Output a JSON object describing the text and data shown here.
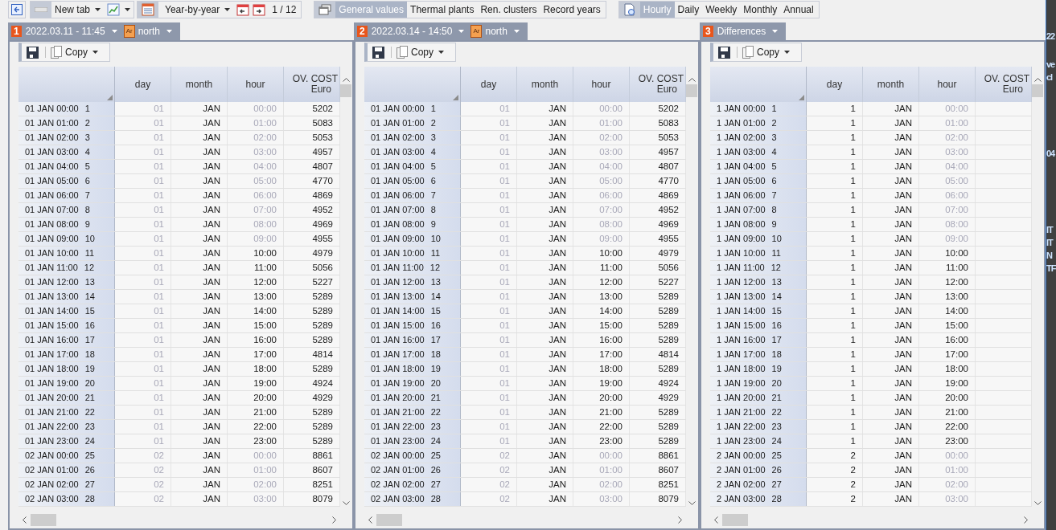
{
  "toolbar": {
    "new_tab": "New tab",
    "mode": "Year-by-year",
    "page": "1 / 12",
    "categories": [
      {
        "label": "General values",
        "selected": true
      },
      {
        "label": "Thermal plants",
        "selected": false
      },
      {
        "label": "Ren. clusters",
        "selected": false
      },
      {
        "label": "Record years",
        "selected": false
      }
    ],
    "periods": [
      {
        "label": "Hourly",
        "selected": true
      },
      {
        "label": "Daily",
        "selected": false
      },
      {
        "label": "Weekly",
        "selected": false
      },
      {
        "label": "Monthly",
        "selected": false
      },
      {
        "label": "Annual",
        "selected": false
      }
    ]
  },
  "panels": [
    {
      "number": "1",
      "title": "2022.03.11 - 11:45",
      "area": {
        "badge": "Ar",
        "name": "north"
      },
      "copy": "Copy",
      "columns": [
        {
          "label": "day"
        },
        {
          "label": "month"
        },
        {
          "label": "hour"
        },
        {
          "label": "OV. COST",
          "unit": "Euro"
        }
      ],
      "rows": [
        {
          "label": "01 JAN 00:00",
          "index": "1",
          "cells": [
            {
              "text": "01",
              "dim": true
            },
            {
              "text": "JAN",
              "dim": false
            },
            {
              "text": "00:00",
              "dim": true
            },
            {
              "text": "5202",
              "dim": false
            }
          ]
        },
        {
          "label": "01 JAN 01:00",
          "index": "2",
          "cells": [
            {
              "text": "01",
              "dim": true
            },
            {
              "text": "JAN",
              "dim": false
            },
            {
              "text": "01:00",
              "dim": true
            },
            {
              "text": "5083",
              "dim": false
            }
          ]
        },
        {
          "label": "01 JAN 02:00",
          "index": "3",
          "cells": [
            {
              "text": "01",
              "dim": true
            },
            {
              "text": "JAN",
              "dim": false
            },
            {
              "text": "02:00",
              "dim": true
            },
            {
              "text": "5053",
              "dim": false
            }
          ]
        },
        {
          "label": "01 JAN 03:00",
          "index": "4",
          "cells": [
            {
              "text": "01",
              "dim": true
            },
            {
              "text": "JAN",
              "dim": false
            },
            {
              "text": "03:00",
              "dim": true
            },
            {
              "text": "4957",
              "dim": false
            }
          ]
        },
        {
          "label": "01 JAN 04:00",
          "index": "5",
          "cells": [
            {
              "text": "01",
              "dim": true
            },
            {
              "text": "JAN",
              "dim": false
            },
            {
              "text": "04:00",
              "dim": true
            },
            {
              "text": "4807",
              "dim": false
            }
          ]
        },
        {
          "label": "01 JAN 05:00",
          "index": "6",
          "cells": [
            {
              "text": "01",
              "dim": true
            },
            {
              "text": "JAN",
              "dim": false
            },
            {
              "text": "05:00",
              "dim": true
            },
            {
              "text": "4770",
              "dim": false
            }
          ]
        },
        {
          "label": "01 JAN 06:00",
          "index": "7",
          "cells": [
            {
              "text": "01",
              "dim": true
            },
            {
              "text": "JAN",
              "dim": false
            },
            {
              "text": "06:00",
              "dim": true
            },
            {
              "text": "4869",
              "dim": false
            }
          ]
        },
        {
          "label": "01 JAN 07:00",
          "index": "8",
          "cells": [
            {
              "text": "01",
              "dim": true
            },
            {
              "text": "JAN",
              "dim": false
            },
            {
              "text": "07:00",
              "dim": true
            },
            {
              "text": "4952",
              "dim": false
            }
          ]
        },
        {
          "label": "01 JAN 08:00",
          "index": "9",
          "cells": [
            {
              "text": "01",
              "dim": true
            },
            {
              "text": "JAN",
              "dim": false
            },
            {
              "text": "08:00",
              "dim": true
            },
            {
              "text": "4969",
              "dim": false
            }
          ]
        },
        {
          "label": "01 JAN 09:00",
          "index": "10",
          "cells": [
            {
              "text": "01",
              "dim": true
            },
            {
              "text": "JAN",
              "dim": false
            },
            {
              "text": "09:00",
              "dim": true
            },
            {
              "text": "4955",
              "dim": false
            }
          ]
        },
        {
          "label": "01 JAN 10:00",
          "index": "11",
          "cells": [
            {
              "text": "01",
              "dim": true
            },
            {
              "text": "JAN",
              "dim": false
            },
            {
              "text": "10:00",
              "dim": false
            },
            {
              "text": "4979",
              "dim": false
            }
          ]
        },
        {
          "label": "01 JAN 11:00",
          "index": "12",
          "cells": [
            {
              "text": "01",
              "dim": true
            },
            {
              "text": "JAN",
              "dim": false
            },
            {
              "text": "11:00",
              "dim": false
            },
            {
              "text": "5056",
              "dim": false
            }
          ]
        },
        {
          "label": "01 JAN 12:00",
          "index": "13",
          "cells": [
            {
              "text": "01",
              "dim": true
            },
            {
              "text": "JAN",
              "dim": false
            },
            {
              "text": "12:00",
              "dim": false
            },
            {
              "text": "5227",
              "dim": false
            }
          ]
        },
        {
          "label": "01 JAN 13:00",
          "index": "14",
          "cells": [
            {
              "text": "01",
              "dim": true
            },
            {
              "text": "JAN",
              "dim": false
            },
            {
              "text": "13:00",
              "dim": false
            },
            {
              "text": "5289",
              "dim": false
            }
          ]
        },
        {
          "label": "01 JAN 14:00",
          "index": "15",
          "cells": [
            {
              "text": "01",
              "dim": true
            },
            {
              "text": "JAN",
              "dim": false
            },
            {
              "text": "14:00",
              "dim": false
            },
            {
              "text": "5289",
              "dim": false
            }
          ]
        },
        {
          "label": "01 JAN 15:00",
          "index": "16",
          "cells": [
            {
              "text": "01",
              "dim": true
            },
            {
              "text": "JAN",
              "dim": false
            },
            {
              "text": "15:00",
              "dim": false
            },
            {
              "text": "5289",
              "dim": false
            }
          ]
        },
        {
          "label": "01 JAN 16:00",
          "index": "17",
          "cells": [
            {
              "text": "01",
              "dim": true
            },
            {
              "text": "JAN",
              "dim": false
            },
            {
              "text": "16:00",
              "dim": false
            },
            {
              "text": "5289",
              "dim": false
            }
          ]
        },
        {
          "label": "01 JAN 17:00",
          "index": "18",
          "cells": [
            {
              "text": "01",
              "dim": true
            },
            {
              "text": "JAN",
              "dim": false
            },
            {
              "text": "17:00",
              "dim": false
            },
            {
              "text": "4814",
              "dim": false
            }
          ]
        },
        {
          "label": "01 JAN 18:00",
          "index": "19",
          "cells": [
            {
              "text": "01",
              "dim": true
            },
            {
              "text": "JAN",
              "dim": false
            },
            {
              "text": "18:00",
              "dim": false
            },
            {
              "text": "5289",
              "dim": false
            }
          ]
        },
        {
          "label": "01 JAN 19:00",
          "index": "20",
          "cells": [
            {
              "text": "01",
              "dim": true
            },
            {
              "text": "JAN",
              "dim": false
            },
            {
              "text": "19:00",
              "dim": false
            },
            {
              "text": "4924",
              "dim": false
            }
          ]
        },
        {
          "label": "01 JAN 20:00",
          "index": "21",
          "cells": [
            {
              "text": "01",
              "dim": true
            },
            {
              "text": "JAN",
              "dim": false
            },
            {
              "text": "20:00",
              "dim": false
            },
            {
              "text": "4929",
              "dim": false
            }
          ]
        },
        {
          "label": "01 JAN 21:00",
          "index": "22",
          "cells": [
            {
              "text": "01",
              "dim": true
            },
            {
              "text": "JAN",
              "dim": false
            },
            {
              "text": "21:00",
              "dim": false
            },
            {
              "text": "5289",
              "dim": false
            }
          ]
        },
        {
          "label": "01 JAN 22:00",
          "index": "23",
          "cells": [
            {
              "text": "01",
              "dim": true
            },
            {
              "text": "JAN",
              "dim": false
            },
            {
              "text": "22:00",
              "dim": false
            },
            {
              "text": "5289",
              "dim": false
            }
          ]
        },
        {
          "label": "01 JAN 23:00",
          "index": "24",
          "cells": [
            {
              "text": "01",
              "dim": true
            },
            {
              "text": "JAN",
              "dim": false
            },
            {
              "text": "23:00",
              "dim": false
            },
            {
              "text": "5289",
              "dim": false
            }
          ]
        },
        {
          "label": "02 JAN 00:00",
          "index": "25",
          "cells": [
            {
              "text": "02",
              "dim": true
            },
            {
              "text": "JAN",
              "dim": false
            },
            {
              "text": "00:00",
              "dim": true
            },
            {
              "text": "8861",
              "dim": false
            }
          ]
        },
        {
          "label": "02 JAN 01:00",
          "index": "26",
          "cells": [
            {
              "text": "02",
              "dim": true
            },
            {
              "text": "JAN",
              "dim": false
            },
            {
              "text": "01:00",
              "dim": true
            },
            {
              "text": "8607",
              "dim": false
            }
          ]
        },
        {
          "label": "02 JAN 02:00",
          "index": "27",
          "cells": [
            {
              "text": "02",
              "dim": true
            },
            {
              "text": "JAN",
              "dim": false
            },
            {
              "text": "02:00",
              "dim": true
            },
            {
              "text": "8251",
              "dim": false
            }
          ]
        },
        {
          "label": "02 JAN 03:00",
          "index": "28",
          "cells": [
            {
              "text": "02",
              "dim": true
            },
            {
              "text": "JAN",
              "dim": false
            },
            {
              "text": "03:00",
              "dim": true
            },
            {
              "text": "8079",
              "dim": false
            }
          ]
        }
      ]
    },
    {
      "number": "2",
      "title": "2022.03.14 - 14:50",
      "area": {
        "badge": "Ar",
        "name": "north"
      },
      "copy": "Copy",
      "columns": [
        {
          "label": "day"
        },
        {
          "label": "month"
        },
        {
          "label": "hour"
        },
        {
          "label": "OV. COST",
          "unit": "Euro"
        }
      ],
      "rows": [
        {
          "label": "01 JAN 00:00",
          "index": "1",
          "cells": [
            {
              "text": "01",
              "dim": true
            },
            {
              "text": "JAN",
              "dim": false
            },
            {
              "text": "00:00",
              "dim": true
            },
            {
              "text": "5202",
              "dim": false
            }
          ]
        },
        {
          "label": "01 JAN 01:00",
          "index": "2",
          "cells": [
            {
              "text": "01",
              "dim": true
            },
            {
              "text": "JAN",
              "dim": false
            },
            {
              "text": "01:00",
              "dim": true
            },
            {
              "text": "5083",
              "dim": false
            }
          ]
        },
        {
          "label": "01 JAN 02:00",
          "index": "3",
          "cells": [
            {
              "text": "01",
              "dim": true
            },
            {
              "text": "JAN",
              "dim": false
            },
            {
              "text": "02:00",
              "dim": true
            },
            {
              "text": "5053",
              "dim": false
            }
          ]
        },
        {
          "label": "01 JAN 03:00",
          "index": "4",
          "cells": [
            {
              "text": "01",
              "dim": true
            },
            {
              "text": "JAN",
              "dim": false
            },
            {
              "text": "03:00",
              "dim": true
            },
            {
              "text": "4957",
              "dim": false
            }
          ]
        },
        {
          "label": "01 JAN 04:00",
          "index": "5",
          "cells": [
            {
              "text": "01",
              "dim": true
            },
            {
              "text": "JAN",
              "dim": false
            },
            {
              "text": "04:00",
              "dim": true
            },
            {
              "text": "4807",
              "dim": false
            }
          ]
        },
        {
          "label": "01 JAN 05:00",
          "index": "6",
          "cells": [
            {
              "text": "01",
              "dim": true
            },
            {
              "text": "JAN",
              "dim": false
            },
            {
              "text": "05:00",
              "dim": true
            },
            {
              "text": "4770",
              "dim": false
            }
          ]
        },
        {
          "label": "01 JAN 06:00",
          "index": "7",
          "cells": [
            {
              "text": "01",
              "dim": true
            },
            {
              "text": "JAN",
              "dim": false
            },
            {
              "text": "06:00",
              "dim": true
            },
            {
              "text": "4869",
              "dim": false
            }
          ]
        },
        {
          "label": "01 JAN 07:00",
          "index": "8",
          "cells": [
            {
              "text": "01",
              "dim": true
            },
            {
              "text": "JAN",
              "dim": false
            },
            {
              "text": "07:00",
              "dim": true
            },
            {
              "text": "4952",
              "dim": false
            }
          ]
        },
        {
          "label": "01 JAN 08:00",
          "index": "9",
          "cells": [
            {
              "text": "01",
              "dim": true
            },
            {
              "text": "JAN",
              "dim": false
            },
            {
              "text": "08:00",
              "dim": true
            },
            {
              "text": "4969",
              "dim": false
            }
          ]
        },
        {
          "label": "01 JAN 09:00",
          "index": "10",
          "cells": [
            {
              "text": "01",
              "dim": true
            },
            {
              "text": "JAN",
              "dim": false
            },
            {
              "text": "09:00",
              "dim": true
            },
            {
              "text": "4955",
              "dim": false
            }
          ]
        },
        {
          "label": "01 JAN 10:00",
          "index": "11",
          "cells": [
            {
              "text": "01",
              "dim": true
            },
            {
              "text": "JAN",
              "dim": false
            },
            {
              "text": "10:00",
              "dim": false
            },
            {
              "text": "4979",
              "dim": false
            }
          ]
        },
        {
          "label": "01 JAN 11:00",
          "index": "12",
          "cells": [
            {
              "text": "01",
              "dim": true
            },
            {
              "text": "JAN",
              "dim": false
            },
            {
              "text": "11:00",
              "dim": false
            },
            {
              "text": "5056",
              "dim": false
            }
          ]
        },
        {
          "label": "01 JAN 12:00",
          "index": "13",
          "cells": [
            {
              "text": "01",
              "dim": true
            },
            {
              "text": "JAN",
              "dim": false
            },
            {
              "text": "12:00",
              "dim": false
            },
            {
              "text": "5227",
              "dim": false
            }
          ]
        },
        {
          "label": "01 JAN 13:00",
          "index": "14",
          "cells": [
            {
              "text": "01",
              "dim": true
            },
            {
              "text": "JAN",
              "dim": false
            },
            {
              "text": "13:00",
              "dim": false
            },
            {
              "text": "5289",
              "dim": false
            }
          ]
        },
        {
          "label": "01 JAN 14:00",
          "index": "15",
          "cells": [
            {
              "text": "01",
              "dim": true
            },
            {
              "text": "JAN",
              "dim": false
            },
            {
              "text": "14:00",
              "dim": false
            },
            {
              "text": "5289",
              "dim": false
            }
          ]
        },
        {
          "label": "01 JAN 15:00",
          "index": "16",
          "cells": [
            {
              "text": "01",
              "dim": true
            },
            {
              "text": "JAN",
              "dim": false
            },
            {
              "text": "15:00",
              "dim": false
            },
            {
              "text": "5289",
              "dim": false
            }
          ]
        },
        {
          "label": "01 JAN 16:00",
          "index": "17",
          "cells": [
            {
              "text": "01",
              "dim": true
            },
            {
              "text": "JAN",
              "dim": false
            },
            {
              "text": "16:00",
              "dim": false
            },
            {
              "text": "5289",
              "dim": false
            }
          ]
        },
        {
          "label": "01 JAN 17:00",
          "index": "18",
          "cells": [
            {
              "text": "01",
              "dim": true
            },
            {
              "text": "JAN",
              "dim": false
            },
            {
              "text": "17:00",
              "dim": false
            },
            {
              "text": "4814",
              "dim": false
            }
          ]
        },
        {
          "label": "01 JAN 18:00",
          "index": "19",
          "cells": [
            {
              "text": "01",
              "dim": true
            },
            {
              "text": "JAN",
              "dim": false
            },
            {
              "text": "18:00",
              "dim": false
            },
            {
              "text": "5289",
              "dim": false
            }
          ]
        },
        {
          "label": "01 JAN 19:00",
          "index": "20",
          "cells": [
            {
              "text": "01",
              "dim": true
            },
            {
              "text": "JAN",
              "dim": false
            },
            {
              "text": "19:00",
              "dim": false
            },
            {
              "text": "4924",
              "dim": false
            }
          ]
        },
        {
          "label": "01 JAN 20:00",
          "index": "21",
          "cells": [
            {
              "text": "01",
              "dim": true
            },
            {
              "text": "JAN",
              "dim": false
            },
            {
              "text": "20:00",
              "dim": false
            },
            {
              "text": "4929",
              "dim": false
            }
          ]
        },
        {
          "label": "01 JAN 21:00",
          "index": "22",
          "cells": [
            {
              "text": "01",
              "dim": true
            },
            {
              "text": "JAN",
              "dim": false
            },
            {
              "text": "21:00",
              "dim": false
            },
            {
              "text": "5289",
              "dim": false
            }
          ]
        },
        {
          "label": "01 JAN 22:00",
          "index": "23",
          "cells": [
            {
              "text": "01",
              "dim": true
            },
            {
              "text": "JAN",
              "dim": false
            },
            {
              "text": "22:00",
              "dim": false
            },
            {
              "text": "5289",
              "dim": false
            }
          ]
        },
        {
          "label": "01 JAN 23:00",
          "index": "24",
          "cells": [
            {
              "text": "01",
              "dim": true
            },
            {
              "text": "JAN",
              "dim": false
            },
            {
              "text": "23:00",
              "dim": false
            },
            {
              "text": "5289",
              "dim": false
            }
          ]
        },
        {
          "label": "02 JAN 00:00",
          "index": "25",
          "cells": [
            {
              "text": "02",
              "dim": true
            },
            {
              "text": "JAN",
              "dim": false
            },
            {
              "text": "00:00",
              "dim": true
            },
            {
              "text": "8861",
              "dim": false
            }
          ]
        },
        {
          "label": "02 JAN 01:00",
          "index": "26",
          "cells": [
            {
              "text": "02",
              "dim": true
            },
            {
              "text": "JAN",
              "dim": false
            },
            {
              "text": "01:00",
              "dim": true
            },
            {
              "text": "8607",
              "dim": false
            }
          ]
        },
        {
          "label": "02 JAN 02:00",
          "index": "27",
          "cells": [
            {
              "text": "02",
              "dim": true
            },
            {
              "text": "JAN",
              "dim": false
            },
            {
              "text": "02:00",
              "dim": true
            },
            {
              "text": "8251",
              "dim": false
            }
          ]
        },
        {
          "label": "02 JAN 03:00",
          "index": "28",
          "cells": [
            {
              "text": "02",
              "dim": true
            },
            {
              "text": "JAN",
              "dim": false
            },
            {
              "text": "03:00",
              "dim": true
            },
            {
              "text": "8079",
              "dim": false
            }
          ]
        }
      ]
    },
    {
      "number": "3",
      "title": "Differences",
      "copy": "Copy",
      "columns": [
        {
          "label": "day"
        },
        {
          "label": "month"
        },
        {
          "label": "hour"
        },
        {
          "label": "OV. COST",
          "unit": "Euro"
        }
      ],
      "rows": [
        {
          "label": "1 JAN 00:00",
          "index": "1",
          "cells": [
            {
              "text": "1",
              "dim": false
            },
            {
              "text": "JAN",
              "dim": false
            },
            {
              "text": "00:00",
              "dim": true
            }
          ]
        },
        {
          "label": "1 JAN 01:00",
          "index": "2",
          "cells": [
            {
              "text": "1",
              "dim": false
            },
            {
              "text": "JAN",
              "dim": false
            },
            {
              "text": "01:00",
              "dim": true
            }
          ]
        },
        {
          "label": "1 JAN 02:00",
          "index": "3",
          "cells": [
            {
              "text": "1",
              "dim": false
            },
            {
              "text": "JAN",
              "dim": false
            },
            {
              "text": "02:00",
              "dim": true
            }
          ]
        },
        {
          "label": "1 JAN 03:00",
          "index": "4",
          "cells": [
            {
              "text": "1",
              "dim": false
            },
            {
              "text": "JAN",
              "dim": false
            },
            {
              "text": "03:00",
              "dim": true
            }
          ]
        },
        {
          "label": "1 JAN 04:00",
          "index": "5",
          "cells": [
            {
              "text": "1",
              "dim": false
            },
            {
              "text": "JAN",
              "dim": false
            },
            {
              "text": "04:00",
              "dim": true
            }
          ]
        },
        {
          "label": "1 JAN 05:00",
          "index": "6",
          "cells": [
            {
              "text": "1",
              "dim": false
            },
            {
              "text": "JAN",
              "dim": false
            },
            {
              "text": "05:00",
              "dim": true
            }
          ]
        },
        {
          "label": "1 JAN 06:00",
          "index": "7",
          "cells": [
            {
              "text": "1",
              "dim": false
            },
            {
              "text": "JAN",
              "dim": false
            },
            {
              "text": "06:00",
              "dim": true
            }
          ]
        },
        {
          "label": "1 JAN 07:00",
          "index": "8",
          "cells": [
            {
              "text": "1",
              "dim": false
            },
            {
              "text": "JAN",
              "dim": false
            },
            {
              "text": "07:00",
              "dim": true
            }
          ]
        },
        {
          "label": "1 JAN 08:00",
          "index": "9",
          "cells": [
            {
              "text": "1",
              "dim": false
            },
            {
              "text": "JAN",
              "dim": false
            },
            {
              "text": "08:00",
              "dim": true
            }
          ]
        },
        {
          "label": "1 JAN 09:00",
          "index": "10",
          "cells": [
            {
              "text": "1",
              "dim": false
            },
            {
              "text": "JAN",
              "dim": false
            },
            {
              "text": "09:00",
              "dim": true
            }
          ]
        },
        {
          "label": "1 JAN 10:00",
          "index": "11",
          "cells": [
            {
              "text": "1",
              "dim": false
            },
            {
              "text": "JAN",
              "dim": false
            },
            {
              "text": "10:00",
              "dim": false
            }
          ]
        },
        {
          "label": "1 JAN 11:00",
          "index": "12",
          "cells": [
            {
              "text": "1",
              "dim": false
            },
            {
              "text": "JAN",
              "dim": false
            },
            {
              "text": "11:00",
              "dim": false
            }
          ]
        },
        {
          "label": "1 JAN 12:00",
          "index": "13",
          "cells": [
            {
              "text": "1",
              "dim": false
            },
            {
              "text": "JAN",
              "dim": false
            },
            {
              "text": "12:00",
              "dim": false
            }
          ]
        },
        {
          "label": "1 JAN 13:00",
          "index": "14",
          "cells": [
            {
              "text": "1",
              "dim": false
            },
            {
              "text": "JAN",
              "dim": false
            },
            {
              "text": "13:00",
              "dim": false
            }
          ]
        },
        {
          "label": "1 JAN 14:00",
          "index": "15",
          "cells": [
            {
              "text": "1",
              "dim": false
            },
            {
              "text": "JAN",
              "dim": false
            },
            {
              "text": "14:00",
              "dim": false
            }
          ]
        },
        {
          "label": "1 JAN 15:00",
          "index": "16",
          "cells": [
            {
              "text": "1",
              "dim": false
            },
            {
              "text": "JAN",
              "dim": false
            },
            {
              "text": "15:00",
              "dim": false
            }
          ]
        },
        {
          "label": "1 JAN 16:00",
          "index": "17",
          "cells": [
            {
              "text": "1",
              "dim": false
            },
            {
              "text": "JAN",
              "dim": false
            },
            {
              "text": "16:00",
              "dim": false
            }
          ]
        },
        {
          "label": "1 JAN 17:00",
          "index": "18",
          "cells": [
            {
              "text": "1",
              "dim": false
            },
            {
              "text": "JAN",
              "dim": false
            },
            {
              "text": "17:00",
              "dim": false
            }
          ]
        },
        {
          "label": "1 JAN 18:00",
          "index": "19",
          "cells": [
            {
              "text": "1",
              "dim": false
            },
            {
              "text": "JAN",
              "dim": false
            },
            {
              "text": "18:00",
              "dim": false
            }
          ]
        },
        {
          "label": "1 JAN 19:00",
          "index": "20",
          "cells": [
            {
              "text": "1",
              "dim": false
            },
            {
              "text": "JAN",
              "dim": false
            },
            {
              "text": "19:00",
              "dim": false
            }
          ]
        },
        {
          "label": "1 JAN 20:00",
          "index": "21",
          "cells": [
            {
              "text": "1",
              "dim": false
            },
            {
              "text": "JAN",
              "dim": false
            },
            {
              "text": "20:00",
              "dim": false
            }
          ]
        },
        {
          "label": "1 JAN 21:00",
          "index": "22",
          "cells": [
            {
              "text": "1",
              "dim": false
            },
            {
              "text": "JAN",
              "dim": false
            },
            {
              "text": "21:00",
              "dim": false
            }
          ]
        },
        {
          "label": "1 JAN 22:00",
          "index": "23",
          "cells": [
            {
              "text": "1",
              "dim": false
            },
            {
              "text": "JAN",
              "dim": false
            },
            {
              "text": "22:00",
              "dim": false
            }
          ]
        },
        {
          "label": "1 JAN 23:00",
          "index": "24",
          "cells": [
            {
              "text": "1",
              "dim": false
            },
            {
              "text": "JAN",
              "dim": false
            },
            {
              "text": "23:00",
              "dim": false
            }
          ]
        },
        {
          "label": "2 JAN 00:00",
          "index": "25",
          "cells": [
            {
              "text": "2",
              "dim": false
            },
            {
              "text": "JAN",
              "dim": false
            },
            {
              "text": "00:00",
              "dim": true
            }
          ]
        },
        {
          "label": "2 JAN 01:00",
          "index": "26",
          "cells": [
            {
              "text": "2",
              "dim": false
            },
            {
              "text": "JAN",
              "dim": false
            },
            {
              "text": "01:00",
              "dim": true
            }
          ]
        },
        {
          "label": "2 JAN 02:00",
          "index": "27",
          "cells": [
            {
              "text": "2",
              "dim": false
            },
            {
              "text": "JAN",
              "dim": false
            },
            {
              "text": "02:00",
              "dim": true
            }
          ]
        },
        {
          "label": "2 JAN 03:00",
          "index": "28",
          "cells": [
            {
              "text": "2",
              "dim": false
            },
            {
              "text": "JAN",
              "dim": false
            },
            {
              "text": "03:00",
              "dim": true
            }
          ]
        }
      ]
    }
  ],
  "side_panel_fragments": [
    "22",
    "ve",
    "cl",
    "04",
    "IT",
    "IT",
    "N",
    "TF"
  ]
}
